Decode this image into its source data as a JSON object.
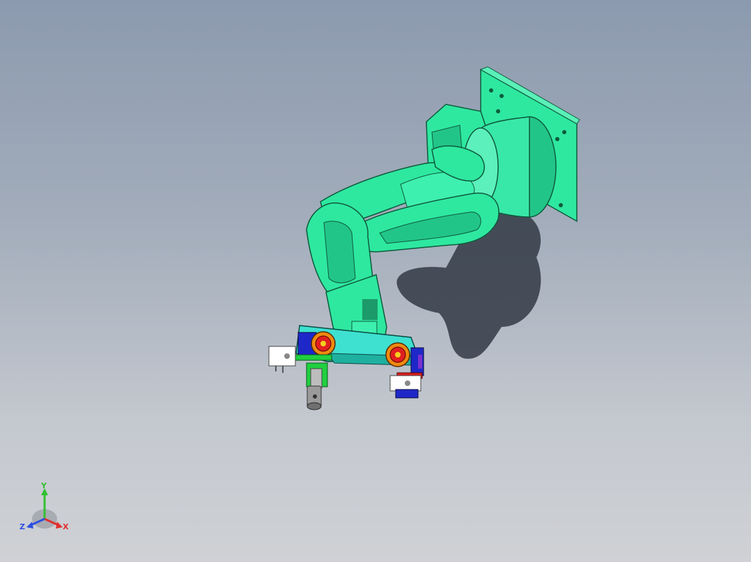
{
  "viewport": {
    "background_top": "#8c9aaf",
    "background_bottom": "#cfd1d5"
  },
  "model": {
    "body_color": "#2ee8a0",
    "body_edge": "#0f5a3c",
    "gripper_red": "#e02020",
    "gripper_orange": "#f08a10",
    "gripper_blue": "#1e28c8",
    "gripper_cyan": "#3ee0d0"
  },
  "triad": {
    "x_label": "X",
    "y_label": "Y",
    "z_label": "Z",
    "x_color": "#e03030",
    "y_color": "#30c030",
    "z_color": "#3050e0"
  }
}
